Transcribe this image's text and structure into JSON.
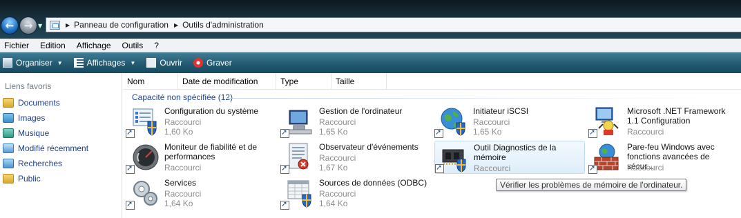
{
  "address": {
    "breadcrumbs": [
      "Panneau de configuration",
      "Outils d'administration"
    ]
  },
  "menubar": [
    "Fichier",
    "Edition",
    "Affichage",
    "Outils",
    "?"
  ],
  "toolbar": {
    "organize": "Organiser",
    "views": "Affichages",
    "open": "Ouvrir",
    "burn": "Graver"
  },
  "sidebar": {
    "title": "Liens favoris",
    "items": [
      {
        "label": "Documents",
        "icon": "folder-icon"
      },
      {
        "label": "Images",
        "icon": "pictures-icon"
      },
      {
        "label": "Musique",
        "icon": "music-icon"
      },
      {
        "label": "Modifié récemment",
        "icon": "recent-icon"
      },
      {
        "label": "Recherches",
        "icon": "search-folder-icon"
      },
      {
        "label": "Public",
        "icon": "public-folder-icon"
      }
    ]
  },
  "columns": [
    "Nom",
    "Date de modification",
    "Type",
    "Taille"
  ],
  "group": "Capacité non spécifiée (12)",
  "items": [
    {
      "name": "Configuration du système",
      "type": "Raccourci",
      "size": "1,60 Ko"
    },
    {
      "name": "Gestion de l'ordinateur",
      "type": "Raccourci",
      "size": "1,65 Ko"
    },
    {
      "name": "Initiateur iSCSI",
      "type": "Raccourci",
      "size": "1,65 Ko"
    },
    {
      "name": "Microsoft .NET Framework 1.1 Configuration",
      "type": "Raccourci",
      "size": ""
    },
    {
      "name": "Moniteur de fiabilité et de performances",
      "type": "Raccourci",
      "size": ""
    },
    {
      "name": "Observateur d'événements",
      "type": "Raccourci",
      "size": "1,67 Ko"
    },
    {
      "name": "Outil Diagnostics de la mémoire",
      "type": "Raccourci",
      "size": ""
    },
    {
      "name": "Pare-feu Windows avec fonctions avancées de sécur...",
      "type": "Raccourci",
      "size": ""
    },
    {
      "name": "Services",
      "type": "Raccourci",
      "size": "1,64 Ko"
    },
    {
      "name": "Sources de données (ODBC)",
      "type": "Raccourci",
      "size": "1,64 Ko"
    }
  ],
  "tooltip": "Vérifier les problèmes de mémoire de l'ordinateur."
}
